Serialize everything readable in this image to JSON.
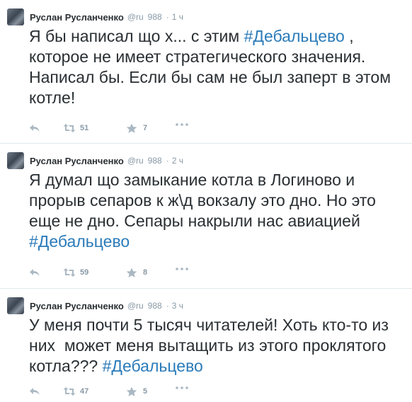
{
  "tweets": [
    {
      "author": {
        "fullname": "Руслан Русланченко",
        "username": "@ru",
        "extra": "988",
        "timestamp": "1 ч"
      },
      "text_parts": [
        {
          "text": "Я бы написал що х... с этим "
        },
        {
          "text": "#Дебальцево",
          "hashtag": true
        },
        {
          "text": " , которое не имеет стратегического значения. Написал бы. Если бы сам не был заперт в этом котле!"
        }
      ],
      "retweets": "51",
      "favorites": "7"
    },
    {
      "author": {
        "fullname": "Руслан Русланченко",
        "username": "@ru",
        "extra": "988",
        "timestamp": "2 ч"
      },
      "text_parts": [
        {
          "text": "Я думал що замыкание котла в Логиново и прорыв сепаров к ж\\д вокзалу это дно. Но это еще не дно. Сепары накрыли нас авиацией "
        },
        {
          "text": "#Дебальцево",
          "hashtag": true
        }
      ],
      "retweets": "59",
      "favorites": "8"
    },
    {
      "author": {
        "fullname": "Руслан Русланченко",
        "username": "@ru",
        "extra": "988",
        "timestamp": "3 ч"
      },
      "text_parts": [
        {
          "text": "У меня почти 5 тысяч читателей! Хоть кто-то из них  может меня вытащить из этого проклятого котла??? "
        },
        {
          "text": "#Дебальцево",
          "hashtag": true
        }
      ],
      "retweets": "47",
      "favorites": "5"
    }
  ],
  "icons": {
    "reply": "reply-icon",
    "retweet": "retweet-icon",
    "favorite": "star-icon",
    "more": "more-icon"
  },
  "colors": {
    "hashtag": "#2b7bb9",
    "meta": "#8899a6",
    "text": "#292f33"
  }
}
